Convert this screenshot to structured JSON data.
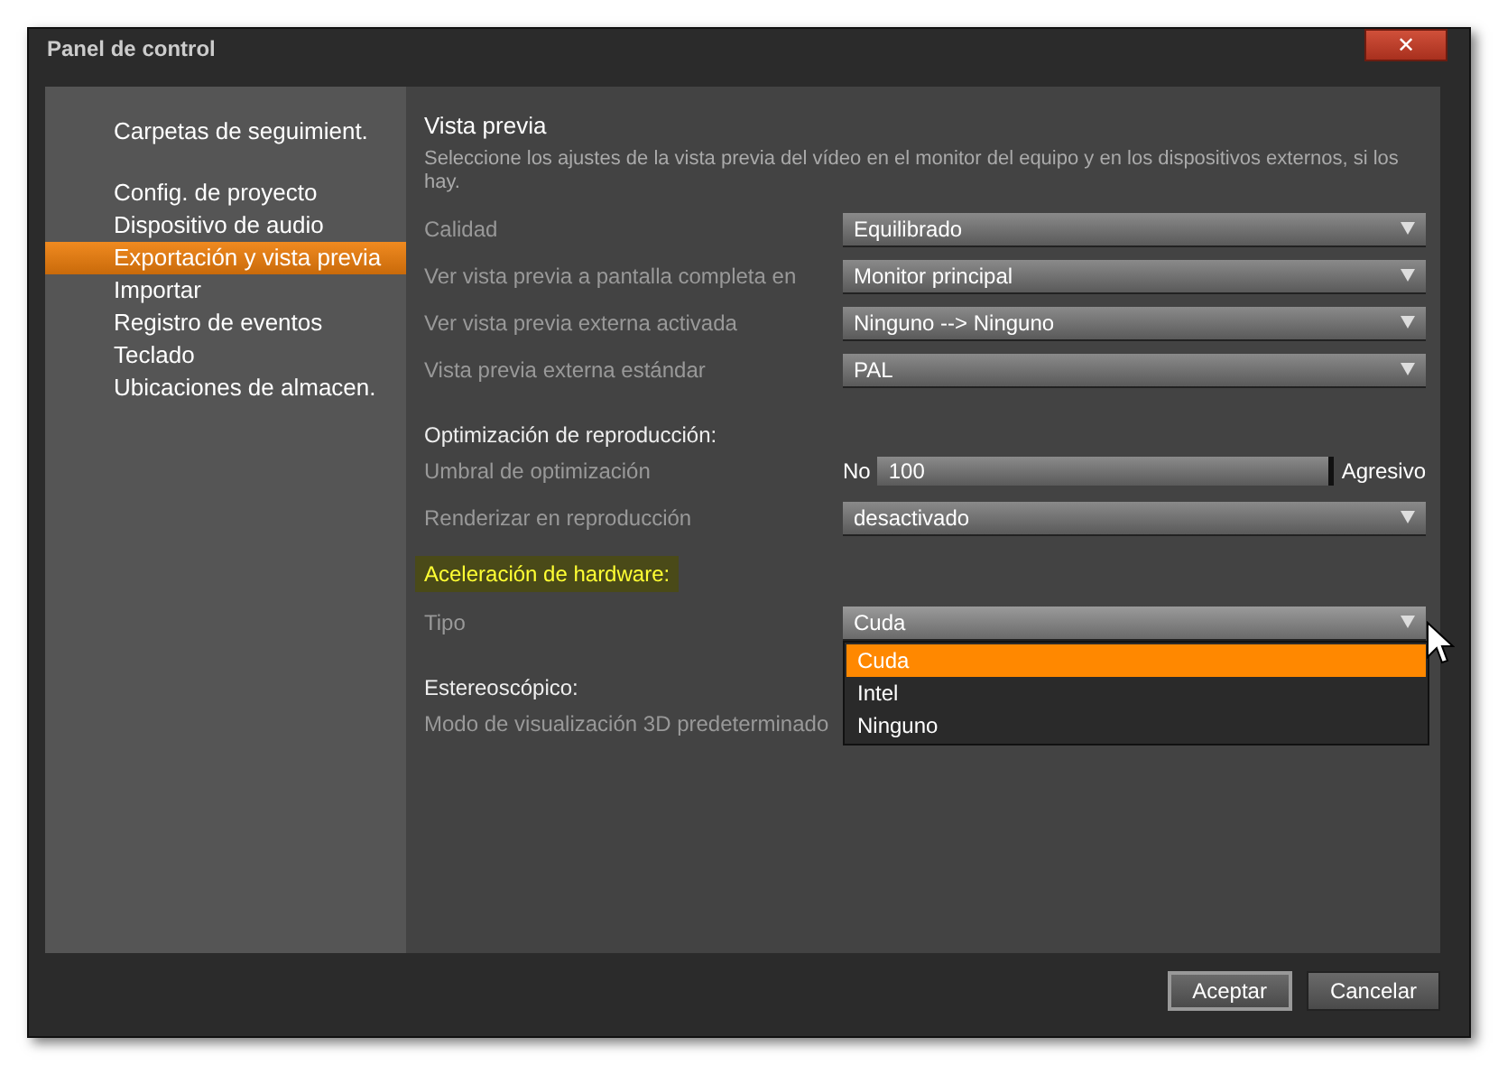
{
  "window": {
    "title": "Panel de control",
    "close": "✕"
  },
  "sidebar": {
    "groups": [
      [
        {
          "label": "Carpetas de seguimient.",
          "selected": false
        }
      ],
      [
        {
          "label": "Config. de proyecto",
          "selected": false
        },
        {
          "label": "Dispositivo de audio",
          "selected": false
        },
        {
          "label": "Exportación y vista previa",
          "selected": true
        },
        {
          "label": "Importar",
          "selected": false
        },
        {
          "label": "Registro de eventos",
          "selected": false
        },
        {
          "label": "Teclado",
          "selected": false
        },
        {
          "label": "Ubicaciones de almacen.",
          "selected": false
        }
      ]
    ]
  },
  "main": {
    "title": "Vista previa",
    "description": "Seleccione los ajustes de la vista previa del vídeo en el monitor del equipo y en los dispositivos externos, si los hay.",
    "rows": [
      {
        "kind": "select",
        "label": "Calidad",
        "value": "Equilibrado"
      },
      {
        "kind": "select",
        "label": "Ver vista previa a pantalla completa en",
        "value": "Monitor principal"
      },
      {
        "kind": "select",
        "label": "Ver vista previa externa activada",
        "value": "Ninguno --> Ninguno"
      },
      {
        "kind": "select",
        "label": "Vista previa externa estándar",
        "value": "PAL"
      },
      {
        "kind": "heading",
        "label": "Optimización de reproducción:",
        "highlighted": false
      },
      {
        "kind": "slider",
        "label": "Umbral de optimización",
        "min_label": "No",
        "value": "100",
        "max_label": "Agresivo",
        "level": 1
      },
      {
        "kind": "select",
        "label": "Renderizar en reproducción",
        "value": "desactivado"
      },
      {
        "kind": "heading",
        "label": "Aceleración de hardware:",
        "highlighted": true
      },
      {
        "kind": "select",
        "label": "Tipo",
        "value": "Cuda",
        "expanded": true,
        "options": [
          {
            "label": "Cuda",
            "selected": true
          },
          {
            "label": "Intel",
            "selected": false
          },
          {
            "label": "Ninguno",
            "selected": false
          }
        ]
      },
      {
        "kind": "heading",
        "label": "Estereoscópico:",
        "highlighted": false
      },
      {
        "kind": "select",
        "label": "Modo de visualización 3D predeterminado"
      }
    ]
  },
  "buttons": [
    {
      "label": "Aceptar",
      "default": true
    },
    {
      "label": "Cancelar",
      "default": false
    }
  ]
}
